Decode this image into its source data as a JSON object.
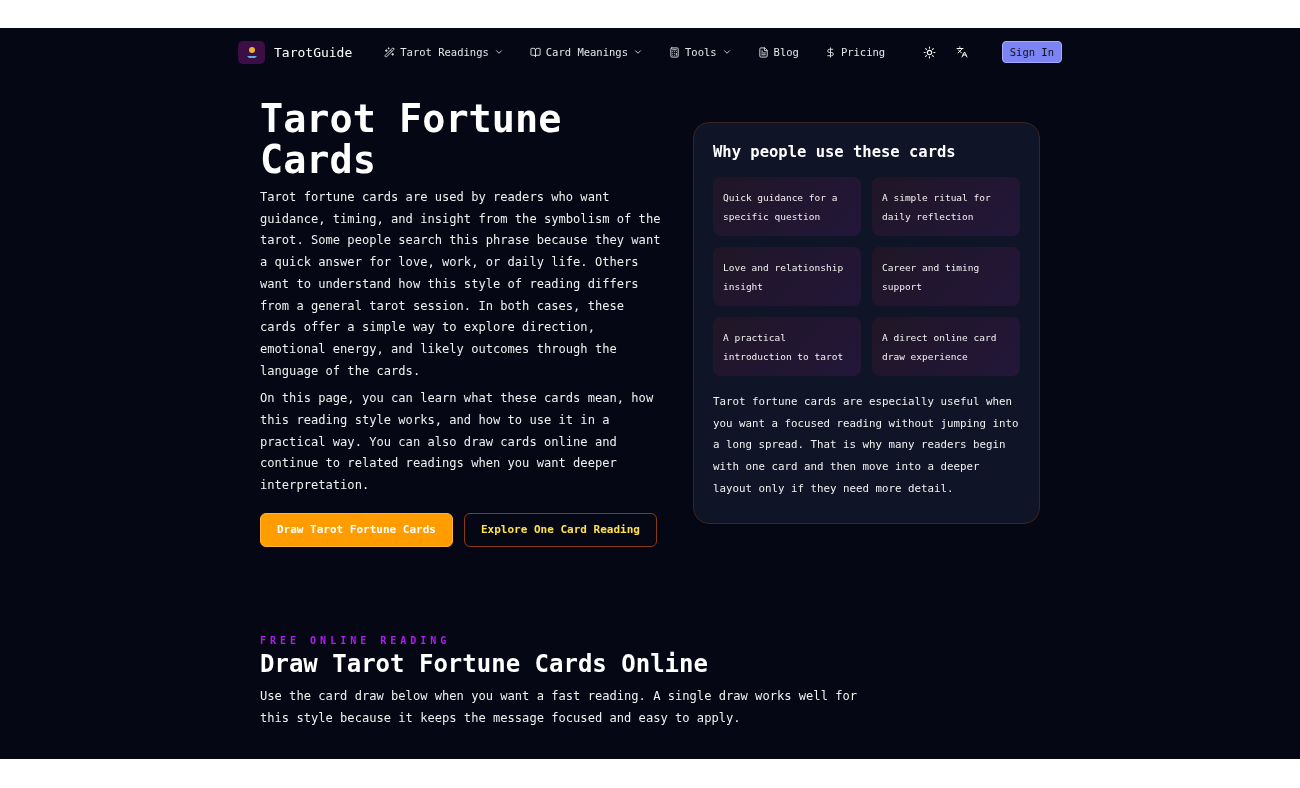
{
  "nav": {
    "brand": "TarotGuide",
    "items": [
      {
        "label": "Tarot Readings",
        "dropdown": true
      },
      {
        "label": "Card Meanings",
        "dropdown": true
      },
      {
        "label": "Tools",
        "dropdown": true
      },
      {
        "label": "Blog",
        "dropdown": false
      },
      {
        "label": "Pricing",
        "dropdown": false
      }
    ],
    "sign_in": "Sign In"
  },
  "hero": {
    "title": "Tarot Fortune Cards",
    "paragraphs": [
      "Tarot fortune cards are used by readers who want guidance, timing, and insight from the symbolism of the tarot. Some people search this phrase because they want a quick answer for love, work, or daily life. Others want to understand how this style of reading differs from a general tarot session. In both cases, these cards offer a simple way to explore direction, emotional energy, and likely outcomes through the language of the cards.",
      "On this page, you can learn what these cards mean, how this reading style works, and how to use it in a practical way. You can also draw cards online and continue to related readings when you want deeper interpretation."
    ],
    "buttons": [
      {
        "label": "Draw Tarot Fortune Cards",
        "kind": "primary"
      },
      {
        "label": "Explore One Card Reading",
        "kind": "outline"
      }
    ]
  },
  "panel": {
    "title": "Why people use these cards",
    "reasons": [
      "Quick guidance for a specific question",
      "A simple ritual for daily reflection",
      "Love and relationship insight",
      "Career and timing support",
      "A practical introduction to tarot",
      "A direct online card draw experience"
    ],
    "text": "Tarot fortune cards are especially useful when you want a focused reading without jumping into a long spread. That is why many readers begin with one card and then move into a deeper layout only if they need more detail."
  },
  "section": {
    "eyebrow": "FREE ONLINE READING",
    "title": "Draw Tarot Fortune Cards Online",
    "text": "Use the card draw below when you want a fast reading. A single draw works well for this style because it keeps the message focused and easy to apply."
  }
}
